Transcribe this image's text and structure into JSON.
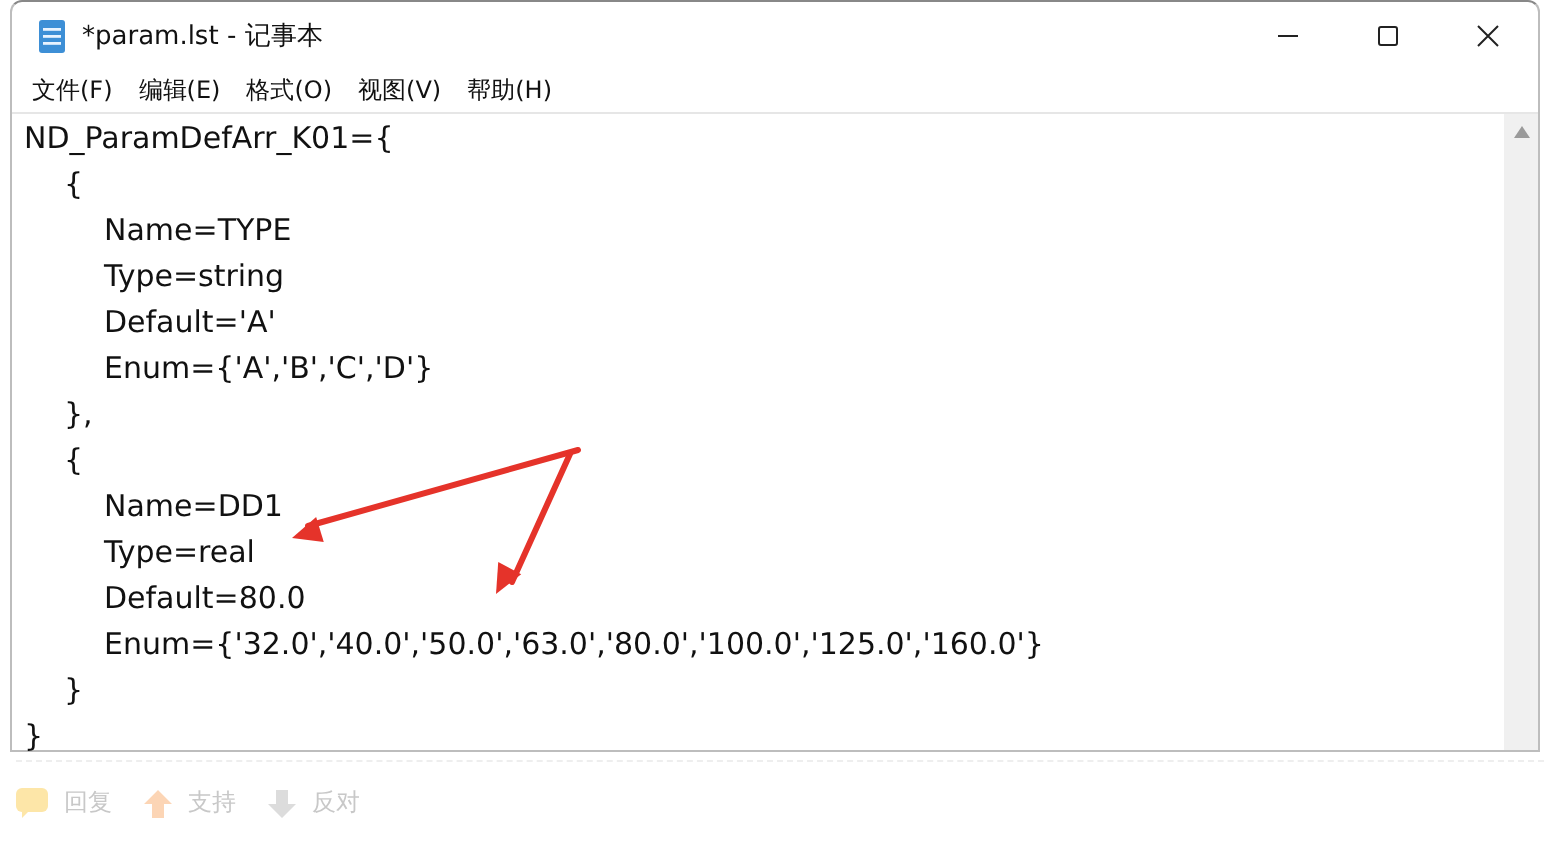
{
  "window": {
    "title": "*param.lst - 记事本",
    "controls": [
      {
        "kind": "minimize"
      },
      {
        "kind": "maximize"
      },
      {
        "kind": "close"
      }
    ]
  },
  "menu": [
    "文件(F)",
    "编辑(E)",
    "格式(O)",
    "视图(V)",
    "帮助(H)"
  ],
  "editor": {
    "lines": [
      "ND_ParamDefArr_K01={",
      "\t{",
      "\t\tName=TYPE",
      "\t\tType=string",
      "\t\tDefault='A'",
      "\t\tEnum={'A','B','C','D'}",
      "\t},",
      "\t{",
      "\t\tName=DD1",
      "\t\tType=real",
      "\t\tDefault=80.0",
      "\t\tEnum={'32.0','40.0','50.0','63.0','80.0','100.0','125.0','160.0'}",
      "\t}",
      "}"
    ]
  },
  "annotations": [
    {
      "kind": "arrow"
    },
    {
      "kind": "arrow"
    }
  ],
  "forum_actions": [
    {
      "kind": "reply",
      "label": "回复"
    },
    {
      "kind": "up",
      "label": "支持"
    },
    {
      "kind": "down",
      "label": "反对"
    }
  ]
}
